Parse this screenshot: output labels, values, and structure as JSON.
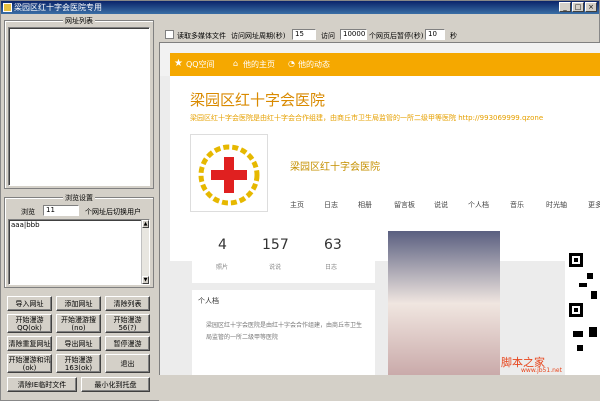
{
  "window": {
    "title": "梁园区红十字会医院专用"
  },
  "left": {
    "url_list_label": "网址列表",
    "browse_settings_label": "浏览设置",
    "browse_label": "浏览",
    "browse_count": "11",
    "switch_user_label": "个网址后切换用户",
    "user_text": "aaa|bbb"
  },
  "buttons": {
    "import_url": "导入网址",
    "add_url": "添加网址",
    "clear_list": "清除列表",
    "start_qq": "开始漫游\nQQ(ok)",
    "start_search": "开始漫游搜\n(no)",
    "start_56": "开始漫游\n56(?)",
    "clear_dup": "清除重复网址",
    "export_url": "导出网址",
    "pause": "暂停漫游",
    "start_news": "开始漫游和讯\n(ok)",
    "start_163": "开始漫游\n163(ok)",
    "exit": "退出",
    "clear_ie": "清除IE临时文件",
    "minimize": "最小化到托盘"
  },
  "toolbar": {
    "read_media": "读取多媒体文件",
    "visit_period_label": "访问网址周期(秒)",
    "visit_period": "15",
    "visit_label": "访问",
    "visit_count": "10000",
    "pause_after_label": "个网页后暂停(秒)",
    "pause_seconds": "10",
    "sec_label": "秒"
  },
  "browser": {
    "qq_space": "QQ空间",
    "his_home": "他的主页",
    "his_feed": "他的动态",
    "site_title": "梁园区红十字会医院",
    "subline": "梁园区红十字会医院是由红十字会合作组建，由商丘市卫生局监管的一所二级甲等医院  http://993069999.qzone",
    "nickname": "梁园区红十字会医院",
    "tabs": [
      "主页",
      "日志",
      "相册",
      "留言板",
      "说说",
      "个人档",
      "音乐",
      "时光轴",
      "更多"
    ],
    "stats": [
      {
        "num": "4",
        "label": "照片"
      },
      {
        "num": "157",
        "label": "说说"
      },
      {
        "num": "63",
        "label": "日志"
      }
    ],
    "profile_header": "个人档",
    "profile_text": "梁园区红十字会医院是由红十字会合作组建，由商丘市卫生局监管的一所二级甲等医院"
  },
  "watermark": {
    "text": "脚本之家",
    "url": "www.jb51.net"
  },
  "colors": {
    "title_start": "#0a246a",
    "title_end": "#3a6ea5",
    "qq_orange": "#f5a800",
    "hospital_red": "#e02020"
  }
}
